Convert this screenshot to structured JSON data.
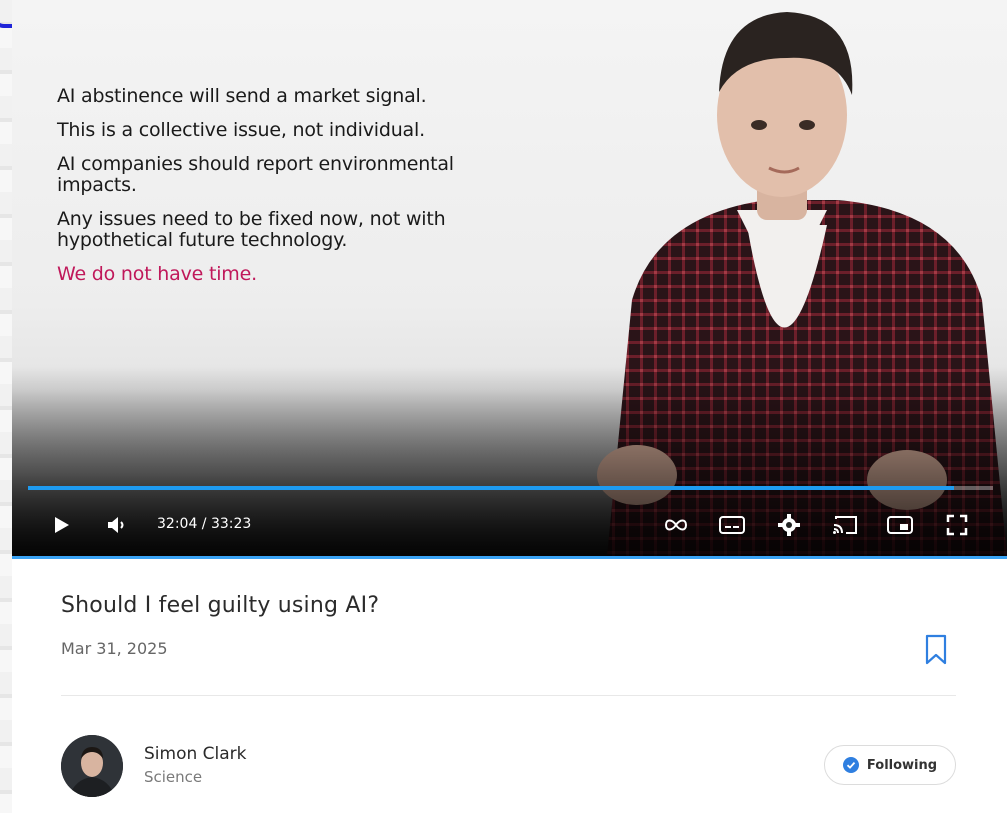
{
  "video": {
    "slide": {
      "lines": [
        "AI abstinence will send a market signal.",
        "This is a collective issue, not individual.",
        "AI companies should report environmental impacts.",
        "Any issues need to be fixed now, not with hypothetical future technology."
      ],
      "emphasis": "We do not have time.",
      "emphasis_color": "#c0185a"
    },
    "player": {
      "time": "32:04 / 33:23",
      "progress": 0.96,
      "accent_color": "#1e9bf0",
      "icons": [
        "play-icon",
        "volume-icon",
        "loop-icon",
        "subtitles-icon",
        "settings-icon",
        "cast-icon",
        "miniplayer-icon",
        "fullscreen-icon"
      ]
    }
  },
  "info": {
    "title": "Should I feel guilty using AI?",
    "date": "Mar 31, 2025",
    "bookmark_icon": "bookmark-icon"
  },
  "author": {
    "name": "Simon Clark",
    "subtitle": "Science",
    "follow_label": "Following",
    "follow_icon": "check-circle-icon",
    "follow_color": "#2f7fe0"
  }
}
